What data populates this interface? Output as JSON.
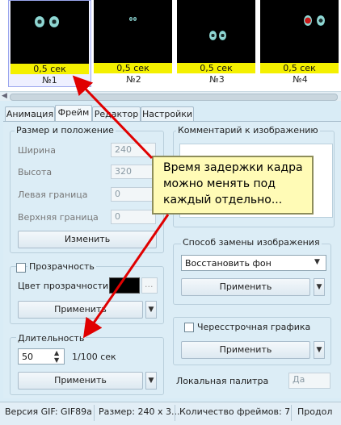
{
  "frames": [
    {
      "delay": "0,5 сек",
      "label": "№1"
    },
    {
      "delay": "0,5 сек",
      "label": "№2"
    },
    {
      "delay": "0,5 сек",
      "label": "№3"
    },
    {
      "delay": "0,5 сек",
      "label": "№4"
    }
  ],
  "tabs": [
    "Анимация",
    "Фрейм",
    "Редактор",
    "Настройки"
  ],
  "size_group": {
    "title": "Размер и положение",
    "width_label": "Ширина",
    "width_value": "240",
    "height_label": "Высота",
    "height_value": "320",
    "left_label": "Левая граница",
    "left_value": "0",
    "top_label": "Верхняя граница",
    "top_value": "0",
    "apply_label": "Изменить"
  },
  "transparency_group": {
    "title": "Прозрачность",
    "color_label": "Цвет прозрачности",
    "color_value": "#000000",
    "more_label": "...",
    "apply_label": "Применить"
  },
  "duration_group": {
    "title": "Длительность",
    "value": "50",
    "unit": "1/100 сек",
    "apply_label": "Применить"
  },
  "comment_group": {
    "title": "Комментарий к изображению"
  },
  "replace_group": {
    "title": "Способ замены изображения",
    "selected": "Восстановить фон",
    "apply_label": "Применить"
  },
  "interlace_group": {
    "title": "Чересстрочная графика",
    "apply_label": "Применить"
  },
  "local_palette": {
    "label": "Локальная палитра",
    "value": "Да"
  },
  "callout": "Время задержки кадра можно менять под каждый отдельно...",
  "status": {
    "version": "Версия GIF: GIF89a",
    "size": "Размер: 240 x 3...",
    "frames": "Количество фреймов: 7",
    "duration": "Продол"
  },
  "colors": {
    "delay_bar": "#f4f000",
    "callout_bg": "#fffbb6",
    "arrow": "#e00000"
  }
}
